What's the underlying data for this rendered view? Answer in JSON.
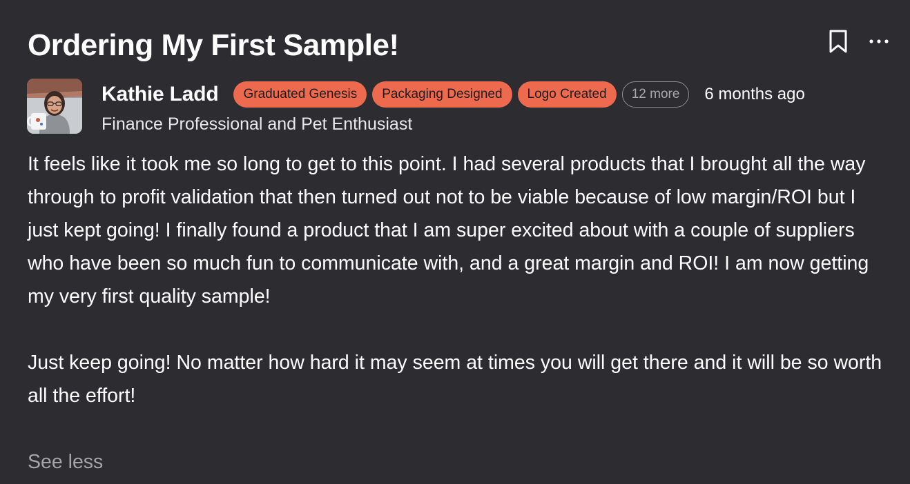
{
  "post": {
    "title": "Ordering My First Sample!",
    "bookmark_icon": "bookmark-icon",
    "more_icon": "more-horizontal-icon",
    "author": {
      "name": "Kathie Ladd",
      "tagline": "Finance Professional and Pet Enthusiast",
      "avatar": "avatar-photo"
    },
    "badges": [
      {
        "label": "Graduated Genesis"
      },
      {
        "label": "Packaging Designed"
      },
      {
        "label": "Logo Created"
      }
    ],
    "more_badges_label": "12 more",
    "timestamp": "6 months ago",
    "body": [
      "It feels like it took me so long to get to this point. I had several products that I brought all the way through to profit validation that then turned out not to be viable because of low margin/ROI but I just kept going! I finally found a product that I am super excited about with a couple of suppliers who have been so much fun to communicate with, and a great margin and ROI! I am now getting my very first quality sample!",
      "Just keep going! No matter how hard it may seem at times you will get there and it will be so worth all the effort!"
    ],
    "see_less_label": "See less"
  },
  "colors": {
    "background": "#2c2c31",
    "badge": "#ee6a4e",
    "badge_text": "#1d1d1f",
    "muted_text": "#a4a4aa"
  }
}
